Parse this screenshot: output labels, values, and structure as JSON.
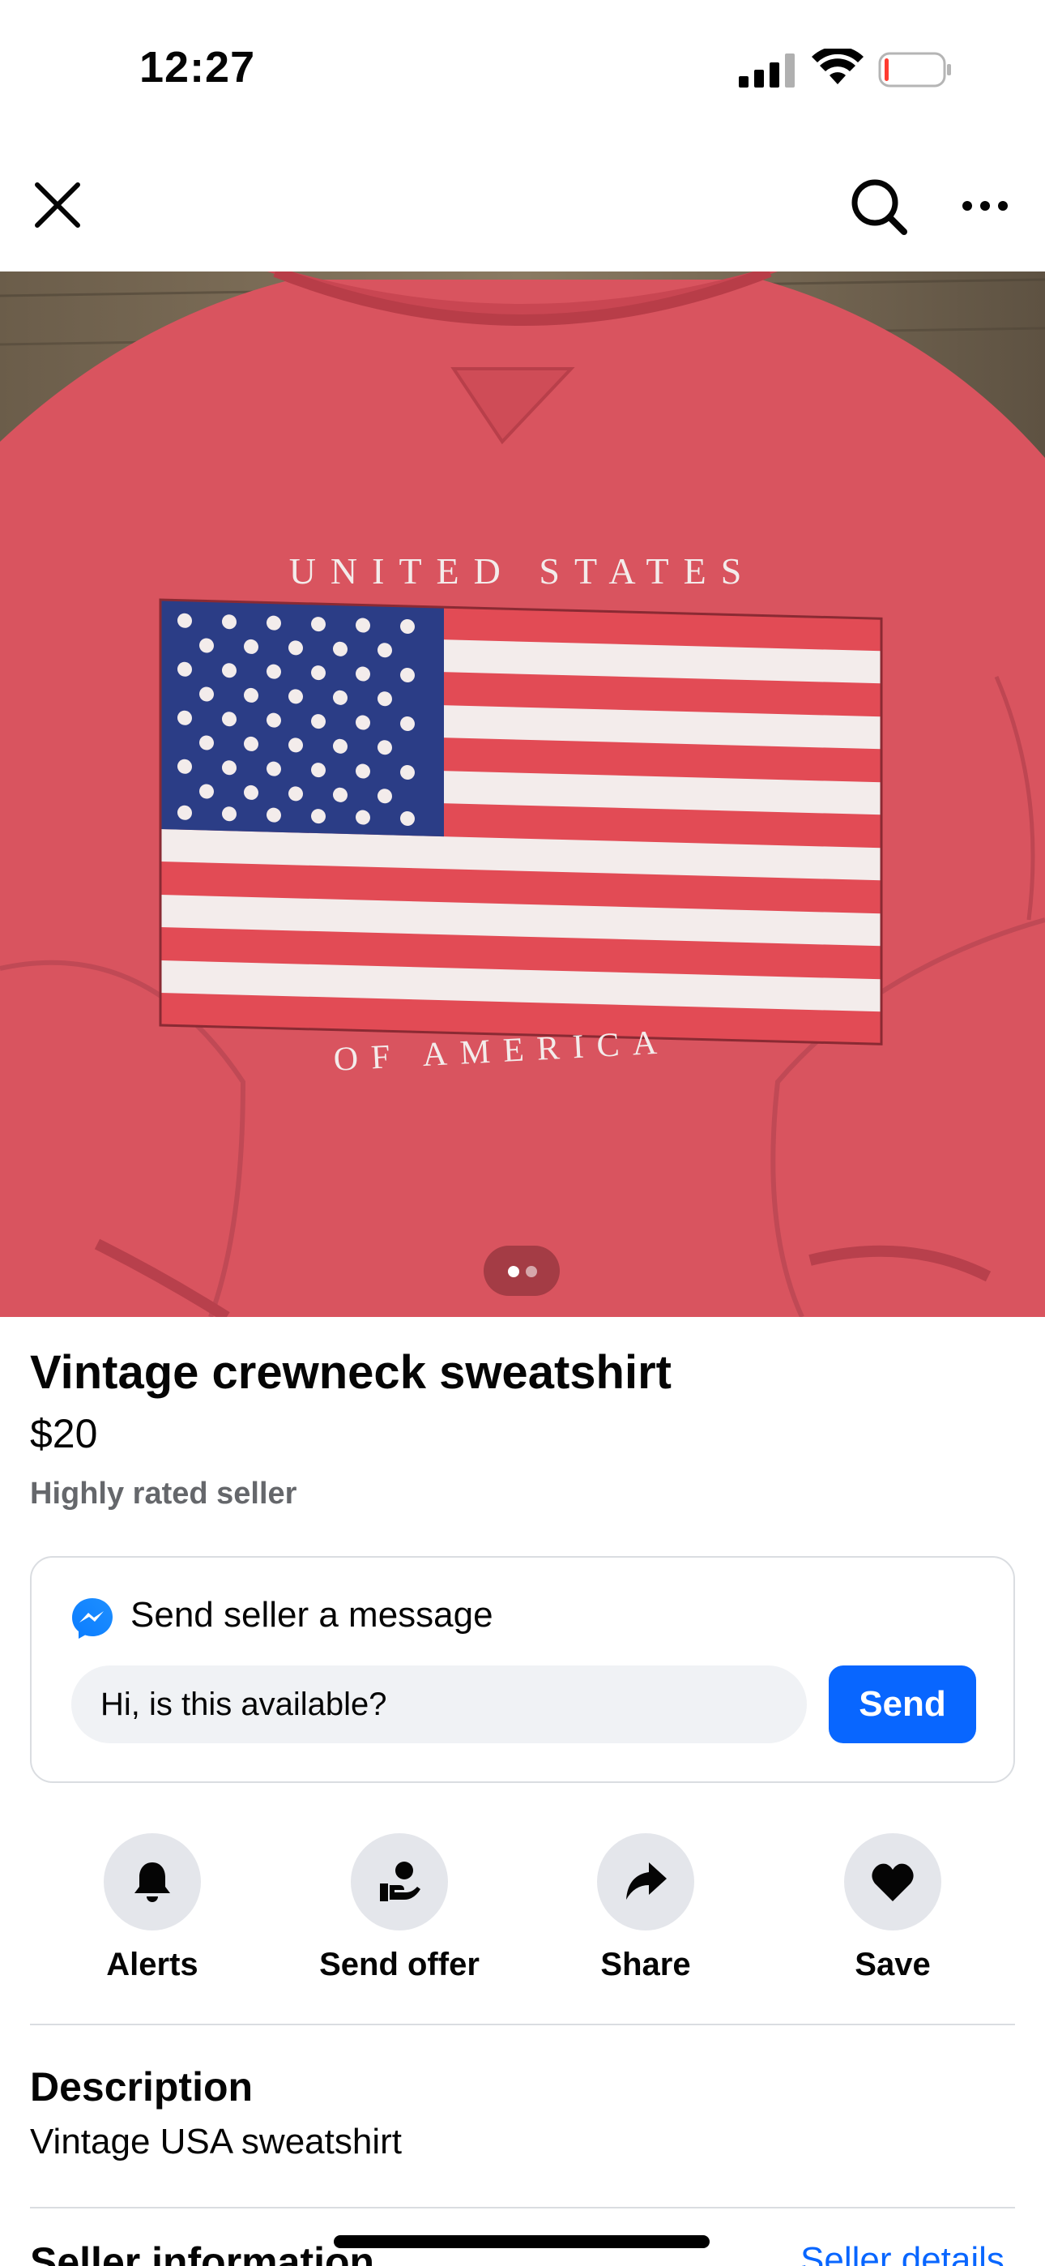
{
  "status_bar": {
    "time": "12:27"
  },
  "listing": {
    "title": "Vintage crewneck sweatshirt",
    "price": "$20",
    "seller_badge": "Highly rated seller",
    "photo_count": 2,
    "photo_index": 1
  },
  "message_card": {
    "header": "Send seller a message",
    "input_value": "Hi, is this available?",
    "send_label": "Send"
  },
  "actions": [
    {
      "label": "Alerts",
      "icon": "bell-icon"
    },
    {
      "label": "Send offer",
      "icon": "offer-icon"
    },
    {
      "label": "Share",
      "icon": "share-icon"
    },
    {
      "label": "Save",
      "icon": "heart-icon"
    }
  ],
  "description": {
    "heading": "Description",
    "text": "Vintage USA sweatshirt"
  },
  "seller_info": {
    "heading": "Seller information",
    "link": "Seller details"
  },
  "photo_text": {
    "top": "UNITED STATES",
    "bottom": "OF AMERICA"
  },
  "colors": {
    "accent": "#0866ff",
    "secondary_text": "#65676b",
    "button_bg": "#e4e6eb"
  }
}
